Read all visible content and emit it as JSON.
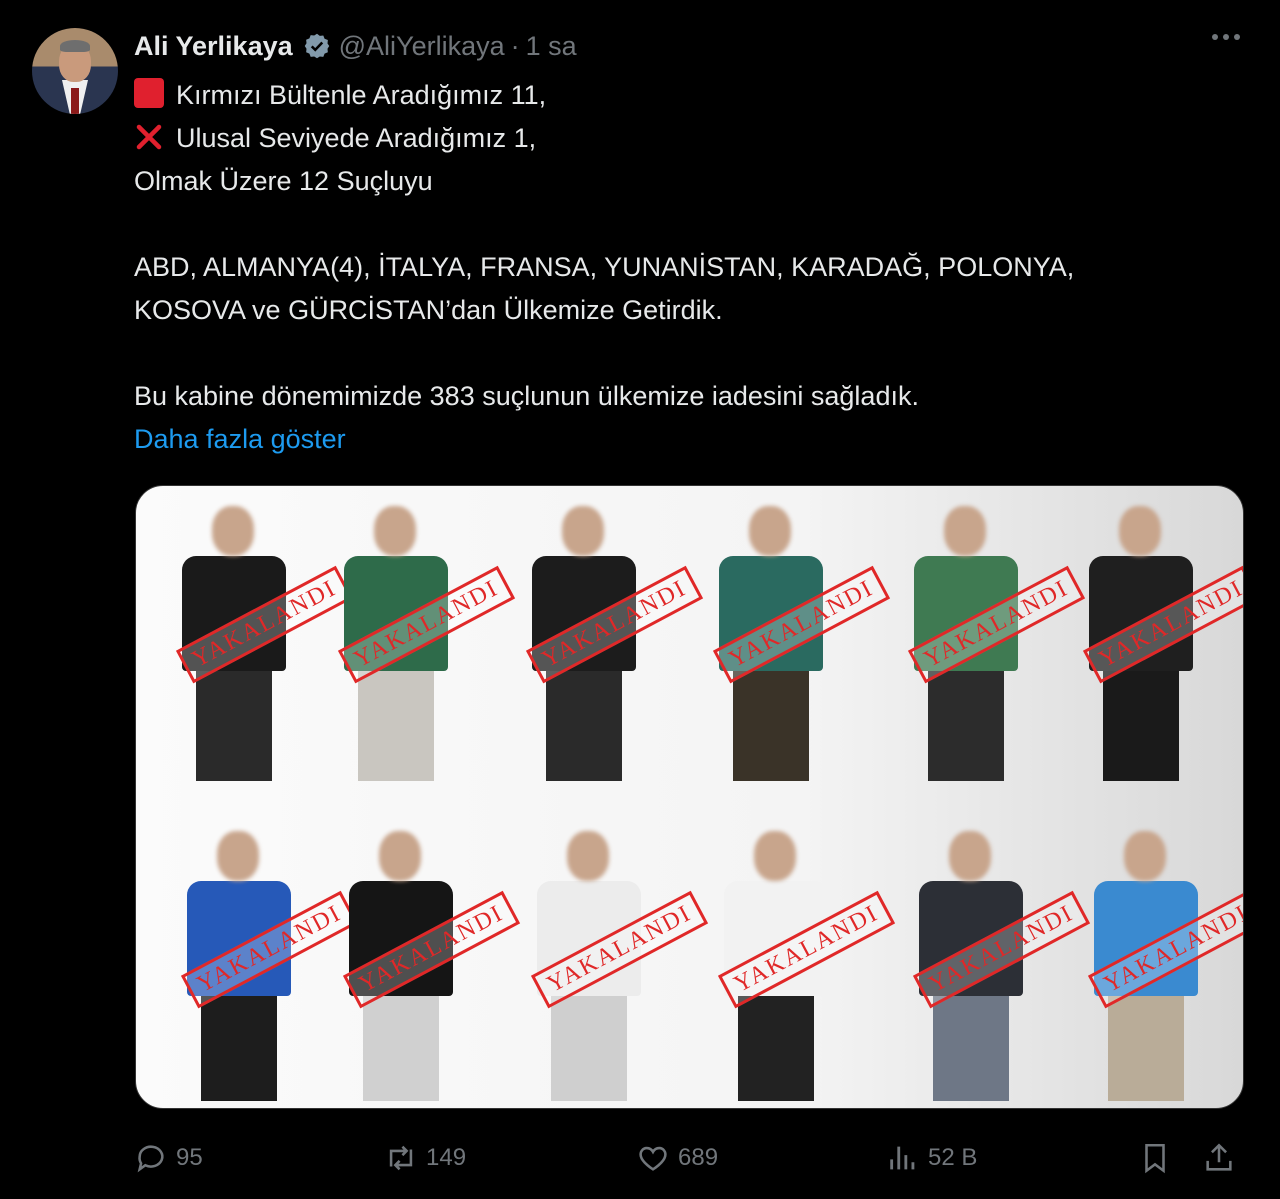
{
  "author": {
    "name": "Ali Yerlikaya",
    "handle": "@AliYerlikaya",
    "separator": "·",
    "time": "1 sa"
  },
  "tweet": {
    "line1": "Kırmızı Bültenle Aradığımız 11,",
    "line2": "Ulusal Seviyede Aradığımız 1,",
    "line3": "Olmak Üzere 12 Suçluyu",
    "line4": "ABD, ALMANYA(4), İTALYA, FRANSA, YUNANİSTAN, KARADAĞ, POLONYA,",
    "line5": "KOSOVA ve GÜRCİSTAN’dan Ülkemize Getirdik.",
    "line6": "Bu kabine dönemimizde 383 suçlunun ülkemize iadesini sağladık.",
    "show_more": "Daha fazla göster"
  },
  "media": {
    "stamp_text": "YAKALANDI",
    "persons": 12
  },
  "actions": {
    "replies": "95",
    "retweets": "149",
    "likes": "689",
    "views": "52 B"
  },
  "icons": [
    "verified-icon",
    "more-icon",
    "reply-icon",
    "retweet-icon",
    "like-icon",
    "views-icon",
    "bookmark-icon",
    "share-icon",
    "red-square-emoji",
    "cross-mark-emoji"
  ],
  "colors": {
    "link": "#1d9bf0",
    "muted": "#71767b",
    "verified": "#829aab",
    "stamp": "#e02828"
  }
}
